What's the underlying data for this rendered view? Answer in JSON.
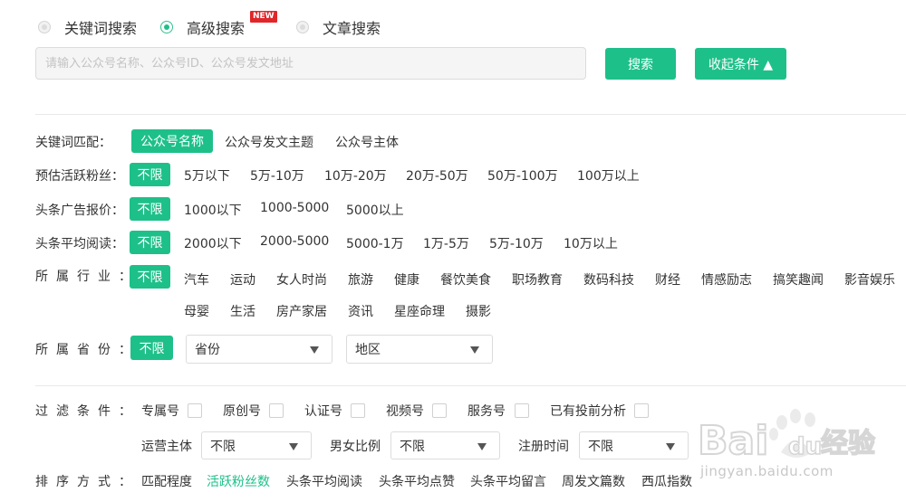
{
  "search_types": [
    {
      "label": "关键词搜索",
      "selected": false
    },
    {
      "label": "高级搜索",
      "selected": true,
      "badge": "NEW"
    },
    {
      "label": "文章搜索",
      "selected": false
    }
  ],
  "search": {
    "placeholder": "请输入公众号名称、公众号ID、公众号发文地址",
    "value": "",
    "search_button": "搜索",
    "collapse_button": "收起条件 ▲"
  },
  "filters": {
    "keyword_match": {
      "label": "关键词匹配：",
      "options": [
        "公众号名称",
        "公众号发文主题",
        "公众号主体"
      ],
      "selected": "公众号名称"
    },
    "fans": {
      "label": "预估活跃粉丝：",
      "unlimited": "不限",
      "options": [
        "5万以下",
        "5万-10万",
        "10万-20万",
        "20万-50万",
        "50万-100万",
        "100万以上"
      ]
    },
    "ad_price": {
      "label": "头条广告报价：",
      "unlimited": "不限",
      "options": [
        "1000以下",
        "1000-5000",
        "5000以上"
      ]
    },
    "avg_read": {
      "label": "头条平均阅读：",
      "unlimited": "不限",
      "options": [
        "2000以下",
        "2000-5000",
        "5000-1万",
        "1万-5万",
        "5万-10万",
        "10万以上"
      ]
    },
    "industry": {
      "label": "所属行业：",
      "unlimited": "不限",
      "options_row1": [
        "汽车",
        "运动",
        "女人时尚",
        "旅游",
        "健康",
        "餐饮美食",
        "职场教育",
        "数码科技",
        "财经",
        "情感励志",
        "搞笑趣闻",
        "影音娱乐"
      ],
      "options_row2": [
        "母婴",
        "生活",
        "房产家居",
        "资讯",
        "星座命理",
        "摄影"
      ]
    },
    "province": {
      "label": "所属省份：",
      "unlimited": "不限",
      "province_select": "省份",
      "region_select": "地区"
    },
    "conditions": {
      "label": "过滤条件：",
      "checkboxes": [
        "专属号",
        "原创号",
        "认证号",
        "视频号",
        "服务号",
        "已有投前分析"
      ],
      "operator_label": "运营主体",
      "operator_value": "不限",
      "gender_label": "男女比例",
      "gender_value": "不限",
      "reg_label": "注册时间",
      "reg_value": "不限"
    },
    "sort": {
      "label": "排序方式：",
      "options": [
        "匹配程度",
        "活跃粉丝数",
        "头条平均阅读",
        "头条平均点赞",
        "头条平均留言",
        "周发文篇数",
        "西瓜指数"
      ],
      "active": "活跃粉丝数"
    }
  },
  "watermark": {
    "logo_text": "Bai du 经验",
    "url": "jingyan.baidu.com"
  },
  "colors": {
    "accent": "#1ec08a",
    "badge": "#e0262a"
  }
}
